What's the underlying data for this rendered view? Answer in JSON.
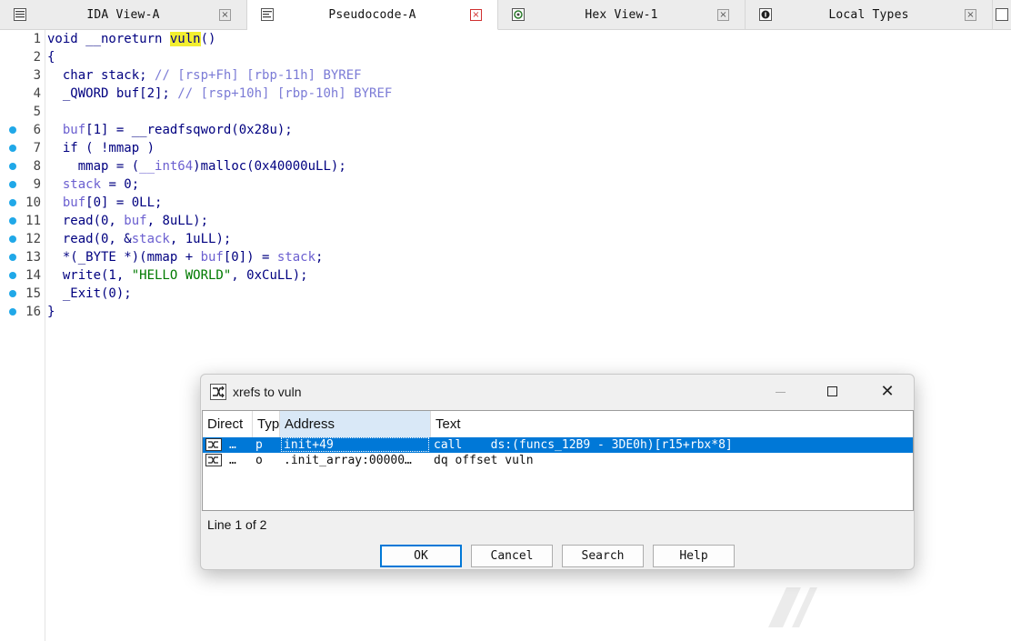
{
  "tabs": [
    {
      "label": "IDA View-A",
      "icon": "disassembly-icon",
      "active": false
    },
    {
      "label": "Pseudocode-A",
      "icon": "pseudocode-icon",
      "active": true
    },
    {
      "label": "Hex View-1",
      "icon": "hex-icon",
      "active": false
    },
    {
      "label": "Local Types",
      "icon": "local-types-icon",
      "active": false
    }
  ],
  "code": {
    "lines": [
      {
        "n": "1",
        "bp": false
      },
      {
        "n": "2",
        "bp": false
      },
      {
        "n": "3",
        "bp": false
      },
      {
        "n": "4",
        "bp": false
      },
      {
        "n": "5",
        "bp": false
      },
      {
        "n": "6",
        "bp": true
      },
      {
        "n": "7",
        "bp": true
      },
      {
        "n": "8",
        "bp": true
      },
      {
        "n": "9",
        "bp": true
      },
      {
        "n": "10",
        "bp": true
      },
      {
        "n": "11",
        "bp": true
      },
      {
        "n": "12",
        "bp": true
      },
      {
        "n": "13",
        "bp": true
      },
      {
        "n": "14",
        "bp": true
      },
      {
        "n": "15",
        "bp": true
      },
      {
        "n": "16",
        "bp": true
      }
    ],
    "l1": {
      "a": "void __noreturn ",
      "fn": "vuln",
      "b": "()"
    },
    "l2": "{",
    "l3": {
      "a": "  char stack; ",
      "c": "// [rsp+Fh] [rbp-11h] BYREF"
    },
    "l4": {
      "a": "  _QWORD buf[2]; ",
      "c": "// [rsp+10h] [rbp-10h] BYREF"
    },
    "l5": "",
    "l6": {
      "v": "buf",
      "a": "[1] = __readfsqword(0x28u);"
    },
    "l7": "  if ( !mmap )",
    "l8": {
      "a": "    mmap = (",
      "t": "__int64",
      "b": ")malloc(0x40000uLL);"
    },
    "l9": {
      "v": "stack",
      "a": " = 0;"
    },
    "l10": {
      "v": "buf",
      "a": "[0] = 0LL;"
    },
    "l11": {
      "a": "  read(0, ",
      "v": "buf",
      "b": ", 8uLL);"
    },
    "l12": {
      "a": "  read(0, &",
      "v": "stack",
      "b": ", 1uLL);"
    },
    "l13": {
      "a": "  *(_BYTE *)(mmap + ",
      "v": "buf",
      "b": "[0]) = ",
      "v2": "stack",
      "c": ";"
    },
    "l14": {
      "a": "  write(1, ",
      "s": "\"HELLO WORLD\"",
      "b": ", 0xCuLL);"
    },
    "l15": "  _Exit(0);",
    "l16": "}"
  },
  "dialog": {
    "title": "xrefs to vuln",
    "columns": [
      "Direct",
      "Typ",
      "Address",
      "Text"
    ],
    "rows": [
      {
        "direct": "…",
        "type": "p",
        "address": "init+49",
        "text": "call    ds:(funcs_12B9 - 3DE0h)[r15+rbx*8]",
        "selected": true
      },
      {
        "direct": "…",
        "type": "o",
        "address": ".init_array:00000…",
        "text": "dq offset vuln",
        "selected": false
      }
    ],
    "status": "Line 1 of 2",
    "buttons": {
      "ok": "OK",
      "cancel": "Cancel",
      "search": "Search",
      "help": "Help"
    }
  },
  "colors": {
    "selection": "#0078d7",
    "breakpoint_dot": "#20a8e8",
    "highlight": "#f2ee30"
  }
}
